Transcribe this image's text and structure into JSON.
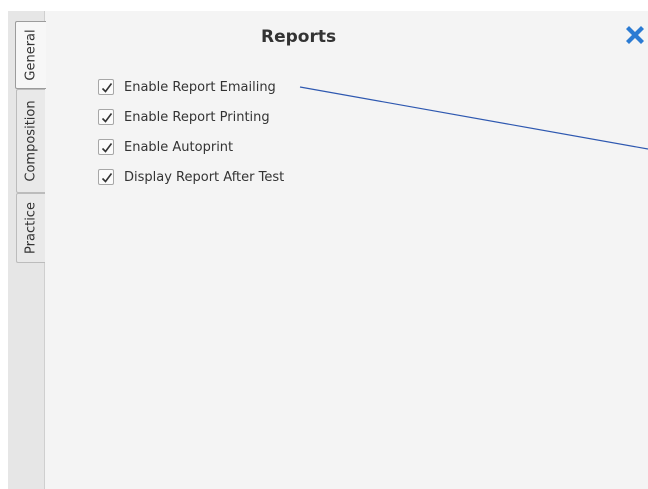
{
  "dialog": {
    "title": "Reports",
    "close_icon": "close-x-icon",
    "accent_color": "#2b7bd3"
  },
  "tabs": [
    {
      "label": "General",
      "active": true
    },
    {
      "label": "Composition",
      "active": false
    },
    {
      "label": "Practice",
      "active": false
    }
  ],
  "options": [
    {
      "label": "Enable Report Emailing",
      "checked": true
    },
    {
      "label": "Enable Report Printing",
      "checked": true
    },
    {
      "label": "Enable Autoprint",
      "checked": true
    },
    {
      "label": "Display Report After Test",
      "checked": true
    }
  ],
  "annotation": {
    "color": "#2e58b0"
  }
}
